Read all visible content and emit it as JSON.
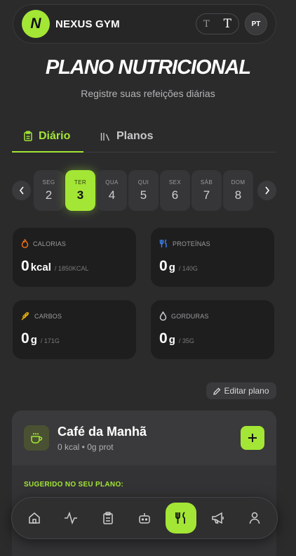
{
  "header": {
    "logo_letter": "N",
    "brand": "NEXUS GYM",
    "font_small": "T",
    "font_large": "T",
    "lang": "PT"
  },
  "page": {
    "title": "PLANO NUTRICIONAL",
    "subtitle": "Registre suas refeições diárias"
  },
  "tabs": [
    {
      "label": "Diário",
      "active": true
    },
    {
      "label": "Planos",
      "active": false
    }
  ],
  "days": [
    {
      "name": "SEG",
      "num": "2"
    },
    {
      "name": "TER",
      "num": "3",
      "selected": true
    },
    {
      "name": "QUA",
      "num": "4"
    },
    {
      "name": "QUI",
      "num": "5"
    },
    {
      "name": "SEX",
      "num": "6"
    },
    {
      "name": "SÁB",
      "num": "7"
    },
    {
      "name": "DOM",
      "num": "8"
    }
  ],
  "stats": {
    "calories": {
      "label": "CALORIAS",
      "value": "0",
      "unit": "kcal",
      "goal": "/ 1850KCAL"
    },
    "protein": {
      "label": "PROTEÍNAS",
      "value": "0",
      "unit": "g",
      "goal": "/ 140G"
    },
    "carbs": {
      "label": "CARBOS",
      "value": "0",
      "unit": "g",
      "goal": "/ 171G"
    },
    "fat": {
      "label": "GORDURAS",
      "value": "0",
      "unit": "g",
      "goal": "/ 35G"
    }
  },
  "edit_plan": "Editar plano",
  "meal": {
    "title": "Café da Manhã",
    "meta": "0 kcal • 0g prot",
    "suggest": "SUGERIDO NO SEU PLANO:"
  },
  "nav": [
    "home-icon",
    "activity-icon",
    "clipboard-icon",
    "robot-icon",
    "utensils-icon",
    "megaphone-icon",
    "user-icon"
  ],
  "colors": {
    "accent": "#a3e635",
    "background": "#2b2b2c",
    "card": "#1e1e1f"
  }
}
